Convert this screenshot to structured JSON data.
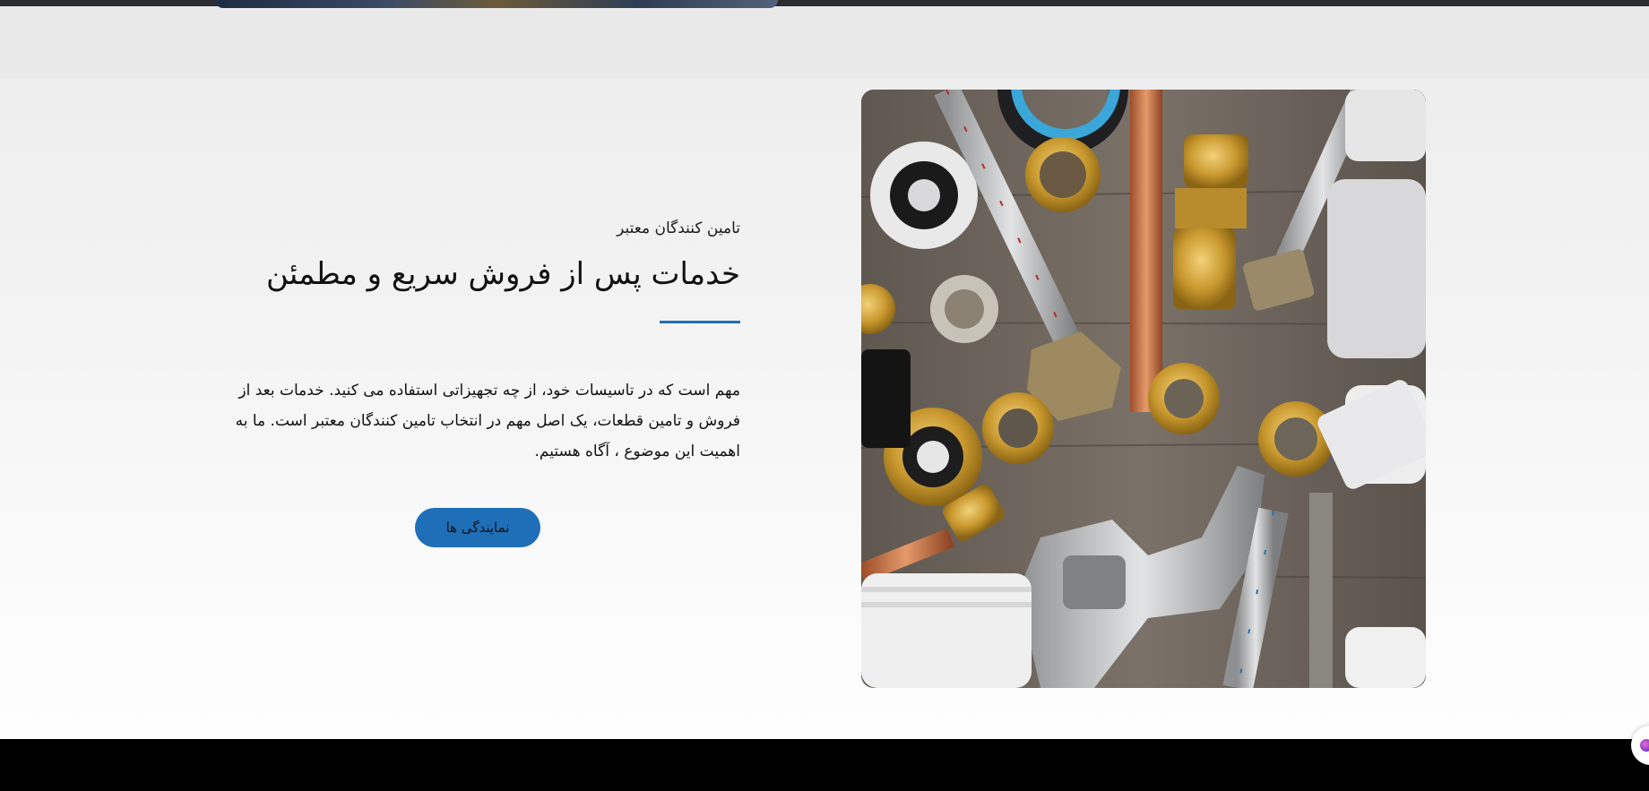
{
  "section": {
    "eyebrow": "تامین کنندگان معتبر",
    "heading": "خدمات پس از فروش سریع و مطمئن",
    "body": "مهم است که در تاسیسات خود، از چه تجهیزاتی استفاده می کنید. خدمات بعد از فروش و تامین قطعات، یک اصل مهم در انتخاب تامین کنندگان معتبر است. ما به اهمیت این موضوع ، آگاه هستیم.",
    "button_label": "نمایندگی ها"
  },
  "colors": {
    "accent": "#1f6fb8",
    "footer": "#000000"
  },
  "icons": {
    "chat": "chat-widget-icon"
  }
}
